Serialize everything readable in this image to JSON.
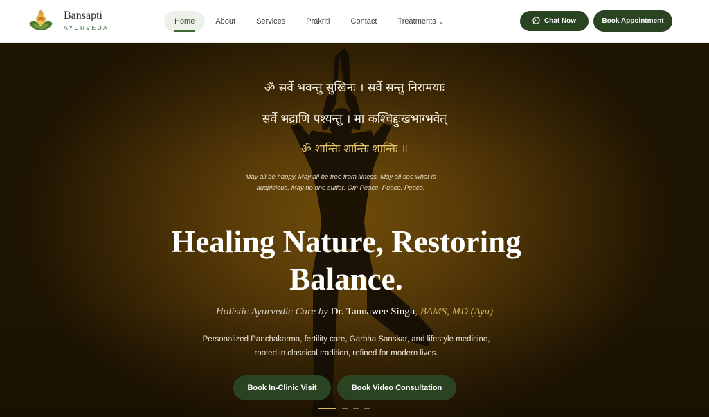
{
  "brand": {
    "name": "Bansapti",
    "tagline": "AYURVEDA"
  },
  "nav": {
    "items": [
      {
        "label": "Home",
        "active": true
      },
      {
        "label": "About"
      },
      {
        "label": "Services"
      },
      {
        "label": "Prakriti"
      },
      {
        "label": "Contact"
      },
      {
        "label": "Treatments",
        "has_dropdown": true
      }
    ]
  },
  "actions": {
    "chat_label": "Chat Now",
    "chat_icon": "whatsapp-icon",
    "book_label": "Book Appointment"
  },
  "hero": {
    "mantra_line1": "ॐ सर्वे भवन्तु सुखिनः । सर्वे सन्तु निरामयाः",
    "mantra_line2": "सर्वे भद्राणि पश्यन्तु । मा कश्चिद्दुःखभाग्भवेत्",
    "mantra_line3": "ॐ शान्तिः शान्तिः शान्तिः ॥",
    "translation": "May all be happy. May all be free from illness. May all see what is auspicious. May no one suffer. Om Peace, Peace, Peace.",
    "headline": "Healing Nature, Restoring Balance.",
    "subline_prefix": "Holistic Ayurvedic Care by",
    "doctor_name": "Dr. Tannawee Singh",
    "credentials": ", BAMS, MD (Ayu)",
    "description": "Personalized Panchakarma, fertility care, Garbha Sanskar, and lifestyle medicine, rooted in classical tradition, refined for modern lives.",
    "cta_primary": "Book In-Clinic Visit",
    "cta_secondary": "Book Video Consultation",
    "slides_total": 4,
    "slide_active": 1
  },
  "colors": {
    "brand_green": "#2a4422",
    "gold": "#d8b45c",
    "hero_brown": "#5a3c08"
  }
}
